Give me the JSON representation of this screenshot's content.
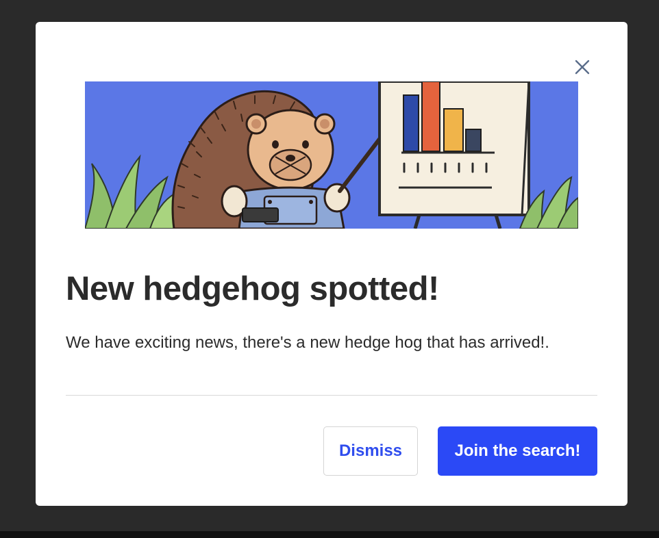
{
  "modal": {
    "title": "New hedgehog spotted!",
    "body": "We have exciting news, there's a new hedge hog that has arrived!.",
    "dismiss_label": "Dismiss",
    "primary_label": "Join the search!",
    "close_icon": "close-icon",
    "image_subject": "hedgehog presenting a bar chart on an easel"
  },
  "colors": {
    "backdrop": "#2a2a2a",
    "primary": "#2b49f6",
    "dismiss_text": "#2f4dee",
    "hero_background": "#5b77e6"
  }
}
